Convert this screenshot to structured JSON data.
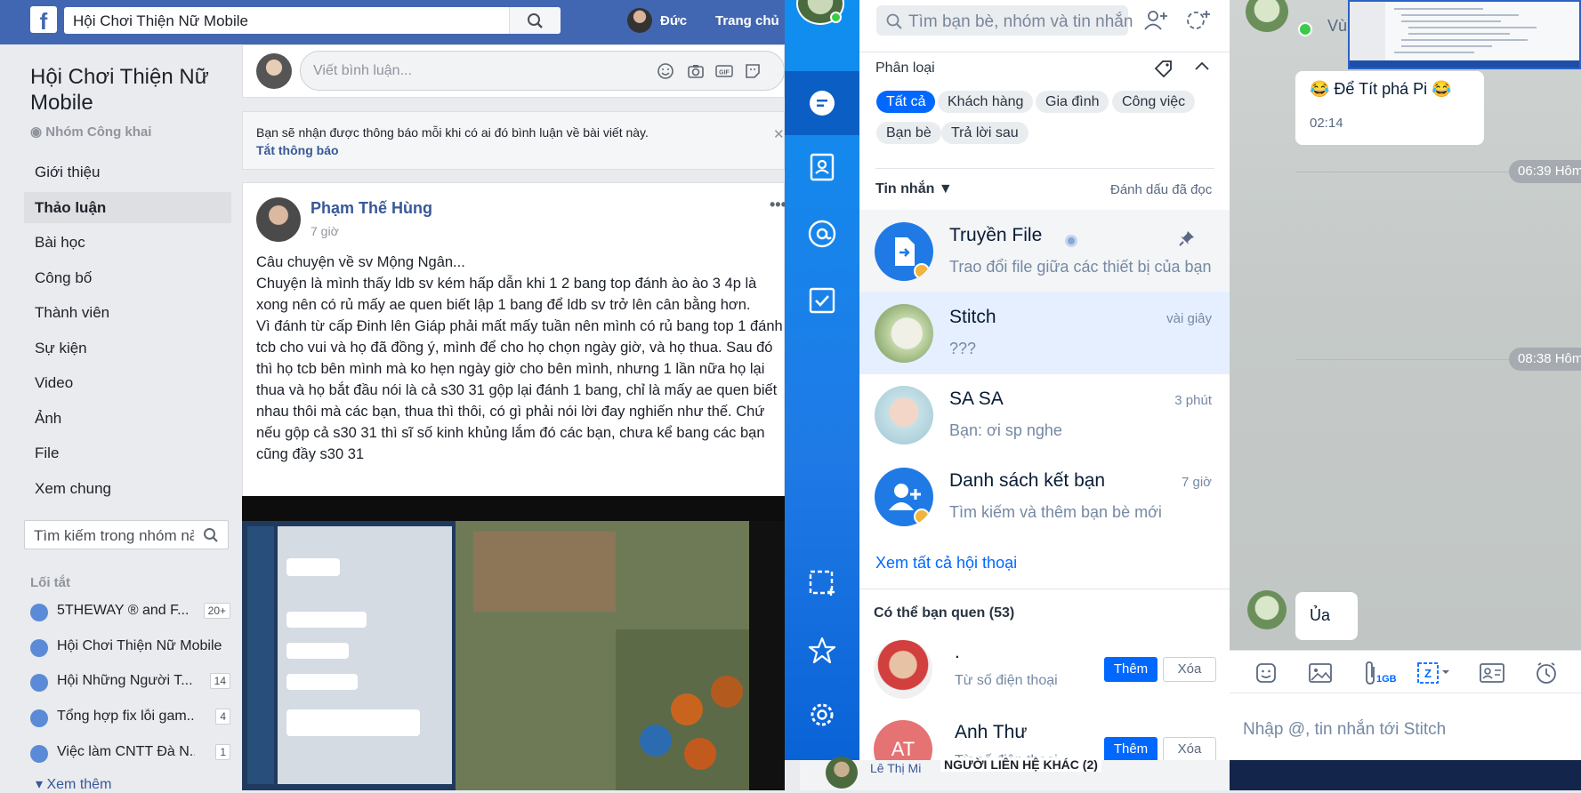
{
  "facebook": {
    "search_value": "Hội Chơi Thiện Nữ Mobile",
    "user_name": "Đức",
    "home_label": "Trang chủ",
    "group": {
      "name": "Hội Chơi Thiện Nữ Mobile",
      "privacy": "Nhóm Công khai",
      "nav": [
        "Giới thiệu",
        "Thảo luận",
        "Bài học",
        "Công bố",
        "Thành viên",
        "Sự kiện",
        "Video",
        "Ảnh",
        "File",
        "Xem chung"
      ],
      "search_placeholder": "Tìm kiếm trong nhóm này"
    },
    "shortcuts": {
      "title": "Lối tắt",
      "items": [
        {
          "label": "5THEWAY ® and F...",
          "count": "20+"
        },
        {
          "label": "Hội Chơi Thiện Nữ Mobile",
          "count": ""
        },
        {
          "label": "Hội Những Người T...",
          "count": "14"
        },
        {
          "label": "Tổng hợp fix lỗi gam...",
          "count": "4"
        },
        {
          "label": "Việc làm CNTT Đà N...",
          "count": "1"
        }
      ],
      "see_more": "Xem thêm"
    },
    "comment_placeholder": "Viết bình luận...",
    "notify_text": "Bạn sẽ nhận được thông báo mỗi khi có ai đó bình luận về bài viết này.",
    "notify_off": "Tắt thông báo",
    "post": {
      "author": "Phạm Thế Hùng",
      "time": "7 giờ",
      "text": "Câu chuyện về sv Mộng Ngân...\nChuyện là mình thấy ldb sv kém hấp dẫn khi 1 2 bang top đánh ào ào 3 4p là xong nên có rủ mấy ae quen biết lập 1 bang để ldb sv trở lên cân bằng hơn.\nVì đánh từ cấp Đinh lên Giáp phải mất mấy tuần nên mình có rủ bang top 1 đánh tcb cho vui và họ đã đồng ý, mình để cho họ chọn ngày giờ, và họ thua. Sau đó thì họ tcb bên mình mà ko hẹn ngày giờ cho bên mình, nhưng 1 lần nữa họ lại thua và họ bắt đầu nói là cả s30 31 gộp lại đánh 1 bang, chỉ là mấy ae quen biết nhau thôi mà các bạn, thua thì thôi, có gì phải nói lời đay nghiến như thế. Chứ nếu gộp cả s30 31 thì sĩ số kinh khủng lắm đó các bạn, chưa kể bang các bạn cũng đầy s30 31"
    }
  },
  "zalo": {
    "search_placeholder": "Tìm bạn bè, nhóm và tin nhắn",
    "category_title": "Phân loại",
    "chips": [
      "Tất cả",
      "Khách hàng",
      "Gia đình",
      "Công việc",
      "Bạn bè",
      "Trả lời sau"
    ],
    "messages_title": "Tin nhắn",
    "mark_read": "Đánh dấu đã đọc",
    "conversations": [
      {
        "name": "Truyền File",
        "preview": "Trao đổi file giữa các thiết bị của bạn",
        "time": ""
      },
      {
        "name": "Stitch",
        "preview": "???",
        "time": "vài giây"
      },
      {
        "name": "SA SA",
        "preview": "Bạn: ơi sp nghe",
        "time": "3 phút"
      },
      {
        "name": "Danh sách kết bạn",
        "preview": "Tìm kiếm và thêm bạn bè mới",
        "time": "7 giờ"
      }
    ],
    "see_all": "Xem tất cả hội thoại",
    "suggest_title": "Có thể bạn quen (53)",
    "suggestions": [
      {
        "name": ".",
        "sub": "Từ số điện thoại",
        "add": "Thêm",
        "remove": "Xóa"
      },
      {
        "name": "Anh Thư",
        "sub": "Từ số điện thoại",
        "add": "Thêm",
        "remove": "Xóa",
        "initials": "AT"
      }
    ]
  },
  "chat": {
    "top_name": "Vù",
    "message1": "😂  Để Tít phá Pi 😂",
    "message1_time": "02:14",
    "day1": "06:39 Hôm",
    "day2": "08:38 Hôm",
    "message2": "Ủa",
    "file_badge": "1GB",
    "input_placeholder": "Nhập @, tin nhắn tới Stitch"
  },
  "bottom": {
    "name": "Lê Thị Mi",
    "label": "NGƯỜI LIÊN HỆ KHÁC (2)"
  },
  "colors": {
    "facebook_blue": "#4267b2",
    "zalo_blue": "#0068ff"
  }
}
